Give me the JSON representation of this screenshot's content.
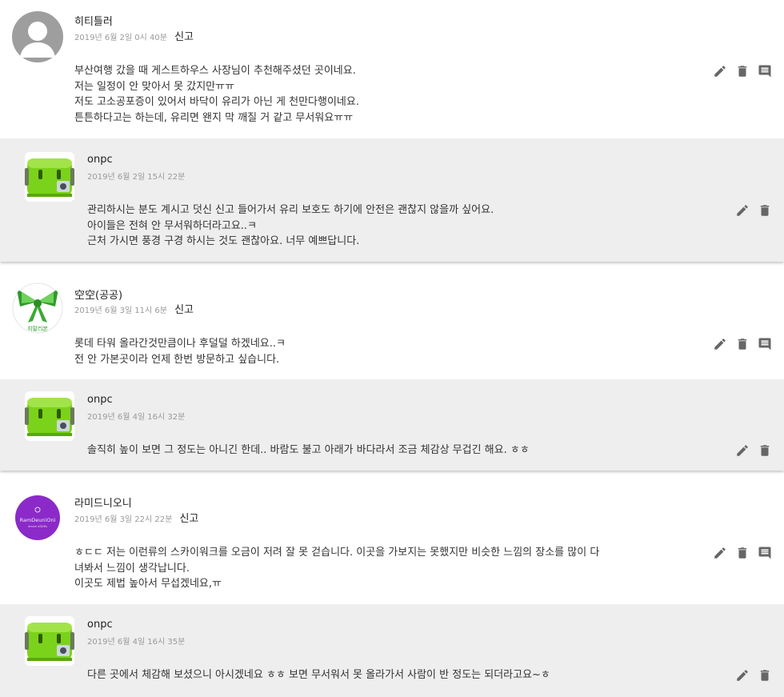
{
  "actions": {
    "edit_icon": "pencil-edit-icon",
    "delete_icon": "trash-delete-icon",
    "reply_icon": "comment-reply-icon"
  },
  "comments": [
    {
      "author": "히티틀러",
      "date": "2019년 6월 2일 0시 40분",
      "report": "신고",
      "lines": [
        "부산여행 갔을 때 게스트하우스 사장님이 추천해주셨던 곳이네요.",
        "저는 일정이 안 맞아서 못 갔지만ㅠㅠ",
        "저도 고소공포증이 있어서 바닥이 유리가 아닌 게 천만다행이네요.",
        "튼튼하다고는 하는데, 유리면 왠지 막 깨질 거 같고 무서워요ㅠㅠ"
      ],
      "reply": {
        "author": "onpc",
        "date": "2019년 6월 2일 15시 22분",
        "lines": [
          "관리하시는 분도 계시고 덧신 신고 들어가서 유리 보호도 하기에 안전은 괜찮지 않을까 싶어요.",
          "아이들은 전혀 안 무서워하더라고요..ㅋ",
          "근처 가시면 풍경 구경 하시는 것도 괜찮아요. 너무 예쁘답니다."
        ]
      }
    },
    {
      "author": "空空(공공)",
      "date": "2019년 6월 3일 11시 6분",
      "report": "신고",
      "avatar_text": "히말리본",
      "lines": [
        "롯데 타워 올라간것만큼이나 후덜덜 하겠네요..ㅋ",
        "전 안 가본곳이라 언제 한번 방문하고 싶습니다."
      ],
      "reply": {
        "author": "onpc",
        "date": "2019년 6월 4일 16시 32분",
        "lines": [
          "솔직히 높이 보면 그 정도는 아니긴 한데.. 바람도 불고 아래가 바다라서 조금 체감상 무겁긴 해요. ㅎㅎ"
        ]
      }
    },
    {
      "author": "라미드니오니",
      "date": "2019년 6월 3일 22시 22분",
      "report": "신고",
      "avatar_text": "RamDeuniOni",
      "avatar_subtext": "dream aDDRs",
      "lines": [
        "ㅎㄷㄷ 저는 이런류의 스카이워크를 오금이 저려 잘 못 걷습니다. 이곳을 가보지는 못했지만 비슷한 느낌의 장소를 많이 다",
        "녀봐서 느낌이 생각납니다.",
        "이곳도 제법 높아서 무섭겠네요,ㅠ"
      ],
      "reply": {
        "author": "onpc",
        "date": "2019년 6월 4일 16시 35분",
        "lines": [
          "다른 곳에서 체감해 보셨으니 아시겠네요 ㅎㅎ 보면 무서워서 못 올라가서 사람이 반 정도는 되더라고요~ㅎ"
        ]
      }
    }
  ]
}
